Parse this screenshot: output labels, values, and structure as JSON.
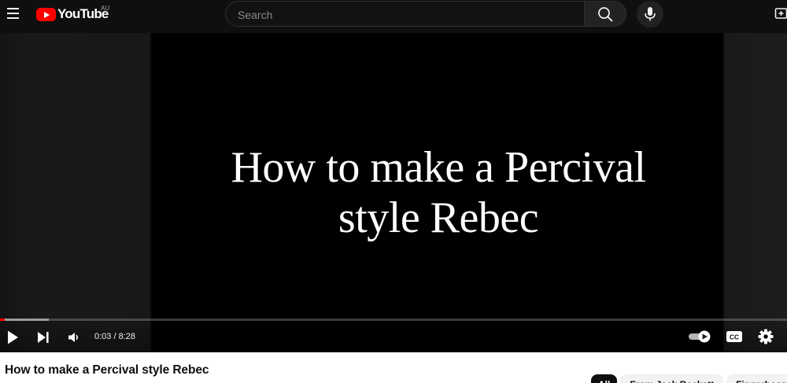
{
  "masthead": {
    "logo_text": "YouTube",
    "region_code": "AU",
    "search": {
      "placeholder": "Search",
      "value": ""
    },
    "icons": [
      "menu-icon",
      "youtube-logo",
      "search-icon",
      "microphone-icon",
      "create-icon"
    ]
  },
  "player": {
    "video_title_line1": "How to make a Percival",
    "video_title_line2": "style Rebec",
    "current_time": "0:03",
    "separator": " / ",
    "duration": "8:28",
    "progress_played_fraction": 0.006,
    "progress_buffered_fraction": 0.062,
    "autoplay_on": true,
    "colors": {
      "progress_played": "#ff0000",
      "background": "#000000"
    },
    "icons": [
      "play-icon",
      "next-icon",
      "volume-icon",
      "autoplay-toggle",
      "captions-icon",
      "settings-icon"
    ]
  },
  "watch": {
    "title": "How to make a Percival style Rebec"
  },
  "chips": [
    {
      "label": "All",
      "active": true
    },
    {
      "label": "From Jack Beckett",
      "active": false
    },
    {
      "label": "Fingerboards",
      "active": false
    }
  ]
}
